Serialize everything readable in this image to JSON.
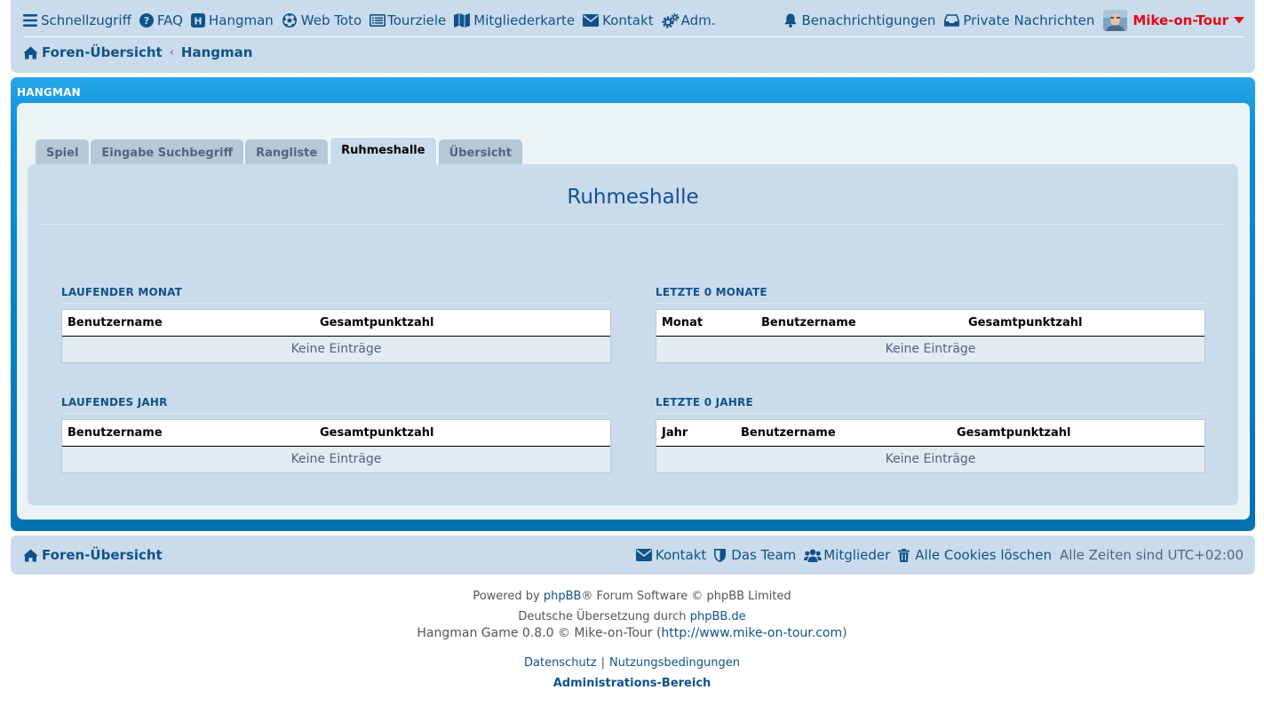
{
  "nav": {
    "items": [
      {
        "label": "Schnellzugriff",
        "icon": "menu-icon"
      },
      {
        "label": "FAQ",
        "icon": "question-circle-icon"
      },
      {
        "label": "Hangman",
        "icon": "h-square-icon"
      },
      {
        "label": "Web Toto",
        "icon": "soccer-ball-icon"
      },
      {
        "label": "Tourziele",
        "icon": "list-box-icon"
      },
      {
        "label": "Mitgliederkarte",
        "icon": "map-icon"
      },
      {
        "label": "Kontakt",
        "icon": "envelope-icon"
      },
      {
        "label": "Adm.",
        "icon": "cogs-icon"
      }
    ],
    "notifications": "Benachrichtigungen",
    "messages": "Private Nachrichten",
    "username": "Mike-on-Tour"
  },
  "breadcrumb": {
    "home": "Foren-Übersicht",
    "current": "Hangman"
  },
  "panel": {
    "title": "HANGMAN",
    "tabs": [
      "Spiel",
      "Eingabe Suchbegriff",
      "Rangliste",
      "Ruhmeshalle",
      "Übersicht"
    ],
    "active_tab": "Ruhmeshalle",
    "heading": "Ruhmeshalle",
    "blocks": {
      "month": {
        "title": "LAUFENDER MONAT",
        "col_user": "Benutzername",
        "col_points": "Gesamtpunktzahl",
        "empty": "Keine Einträge"
      },
      "last_months": {
        "title": "LETZTE 0 MONATE",
        "col_period": "Monat",
        "col_user": "Benutzername",
        "col_points": "Gesamtpunktzahl",
        "empty": "Keine Einträge"
      },
      "year": {
        "title": "LAUFENDES JAHR",
        "col_user": "Benutzername",
        "col_points": "Gesamtpunktzahl",
        "empty": "Keine Einträge"
      },
      "last_years": {
        "title": "LETZTE 0 JAHRE",
        "col_period": "Jahr",
        "col_user": "Benutzername",
        "col_points": "Gesamtpunktzahl",
        "empty": "Keine Einträge"
      }
    }
  },
  "footer": {
    "home": "Foren-Übersicht",
    "contact": "Kontakt",
    "team": "Das Team",
    "members": "Mitglieder",
    "cookies": "Alle Cookies löschen",
    "timezone": "Alle Zeiten sind UTC+02:00"
  },
  "copyright": {
    "powered_prefix": "Powered by",
    "phpbb": "phpBB",
    "powered_suffix": "® Forum Software © phpBB Limited",
    "translation_prefix": "Deutsche Übersetzung durch",
    "translation_link": "phpBB.de",
    "hangman_prefix": "Hangman Game 0.8.0 © Mike-on-Tour (",
    "hangman_link": "http://www.mike-on-tour.com",
    "hangman_suffix": ")",
    "privacy": "Datenschutz",
    "separator": "|",
    "terms": "Nutzungsbedingungen",
    "admin": "Administrations-Bereich"
  },
  "colors": {
    "accent": "#105289",
    "header_bg": "#cadceb",
    "panel_blue": "#0b8fd8",
    "username": "#e1081a"
  }
}
